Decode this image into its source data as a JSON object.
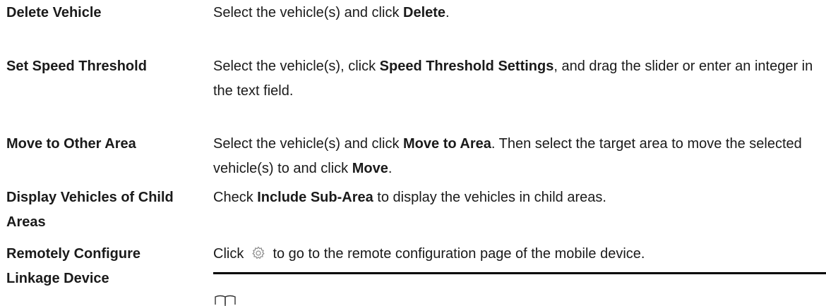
{
  "rows": [
    {
      "term": "Delete Vehicle",
      "desc": [
        {
          "t": "Select the vehicle(s) and click "
        },
        {
          "t": "Delete",
          "b": true
        },
        {
          "t": "."
        }
      ]
    },
    {
      "term": "Set Speed Threshold",
      "desc": [
        {
          "t": "Select the vehicle(s), click "
        },
        {
          "t": "Speed Threshold Settings",
          "b": true
        },
        {
          "t": ", and drag the slider or enter an integer in the text field."
        }
      ]
    },
    {
      "term": "Move to Other Area",
      "desc": [
        {
          "t": "Select the vehicle(s) and click "
        },
        {
          "t": "Move to Area",
          "b": true
        },
        {
          "t": ". Then select the target area to move the selected vehicle(s) to and click "
        },
        {
          "t": "Move",
          "b": true
        },
        {
          "t": "."
        }
      ]
    },
    {
      "term": "Display Vehicles of Child Areas",
      "desc": [
        {
          "t": "Check "
        },
        {
          "t": "Include Sub-Area",
          "b": true
        },
        {
          "t": " to display the vehicles in child areas."
        }
      ]
    },
    {
      "term": "Remotely Configure Linkage Device",
      "desc": [
        {
          "t": "Click "
        },
        {
          "icon": "gear-icon"
        },
        {
          "t": " to go to the remote configuration page of the mobile device."
        }
      ]
    }
  ],
  "note_icon": "note-icon"
}
